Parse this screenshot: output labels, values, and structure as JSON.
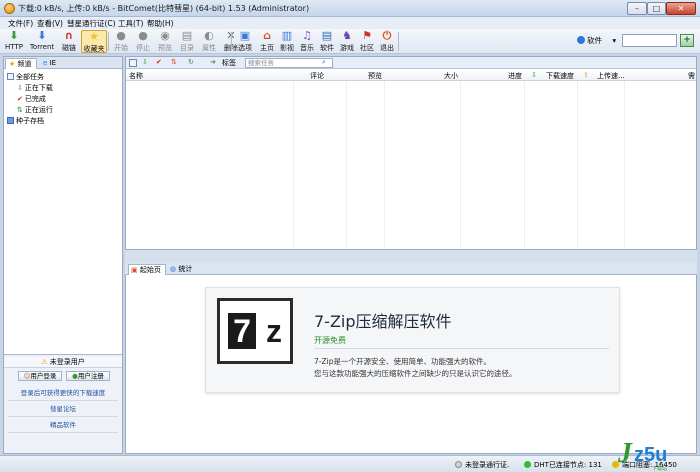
{
  "window": {
    "title": "下载:0 kB/s, 上传:0 kB/s - BitComet(比特彗星) (64-bit) 1.53 (Administrator)",
    "controls": [
      "–",
      "□",
      "✕"
    ]
  },
  "menu": [
    "文件(F)",
    "查看(V)",
    "彗星通行证(C)",
    "工具(T)",
    "帮助(H)"
  ],
  "toolbar": {
    "buttons": [
      {
        "label": "HTTP",
        "icon": "http-icon",
        "color": "#3c9b3c"
      },
      {
        "label": "Torrent",
        "icon": "torrent-icon",
        "color": "#3c7bd6"
      },
      {
        "label": "磁链",
        "icon": "magnet-icon",
        "color": "#d23b2b"
      },
      {
        "label": "收藏夹",
        "icon": "star-icon",
        "color": "#f2c230"
      },
      {
        "label": "开始",
        "icon": "start-icon",
        "color": "#8c8c8c"
      },
      {
        "label": "停止",
        "icon": "stop-icon",
        "color": "#8c8c8c"
      },
      {
        "label": "预览",
        "icon": "preview-icon",
        "color": "#8c8c8c"
      },
      {
        "label": "目录",
        "icon": "folder-icon",
        "color": "#8c8c8c"
      },
      {
        "label": "属性",
        "icon": "properties-icon",
        "color": "#8c8c8c"
      },
      {
        "label": "删除",
        "icon": "delete-icon",
        "color": "#6a6a6a"
      },
      {
        "label": "选项",
        "icon": "options-icon",
        "color": "#3c7bd6"
      },
      {
        "label": "主页",
        "icon": "home-icon",
        "color": "#d2542b"
      },
      {
        "label": "影视",
        "icon": "video-icon",
        "color": "#3c7bd6"
      },
      {
        "label": "音乐",
        "icon": "music-icon",
        "color": "#7c4fc9"
      },
      {
        "label": "软件",
        "icon": "software-icon",
        "color": "#2b6cb5"
      },
      {
        "label": "游戏",
        "icon": "game-icon",
        "color": "#6b3fb5"
      },
      {
        "label": "社区",
        "icon": "community-icon",
        "color": "#c9352b"
      },
      {
        "label": "退出",
        "icon": "exit-icon",
        "color": "#e0541f"
      }
    ],
    "search_category": "软件",
    "search_value": "",
    "search_go": "+"
  },
  "left": {
    "tabs": [
      "频道",
      "IE"
    ],
    "tree": [
      {
        "label": "全部任务",
        "icon": "all-tasks-icon",
        "color": "#ffffff"
      },
      {
        "label": "正在下载",
        "icon": "download-arrow-icon",
        "color": "#2ea02e"
      },
      {
        "label": "已完成",
        "icon": "check-icon",
        "color": "#d22a2a"
      },
      {
        "label": "正在运行",
        "icon": "running-icon",
        "color": "#2e8b2e"
      },
      {
        "label": "种子存档",
        "icon": "archive-icon",
        "color": "#3c7bd6"
      }
    ],
    "login": {
      "title": "未登录用户",
      "login_btn": "用户登录",
      "register_btn": "用户注册",
      "links": [
        "登录后可获得更快的下载速度",
        "彗星论坛",
        "精品软件"
      ]
    }
  },
  "tasks": {
    "toolbar_label": "标签",
    "search_placeholder": "搜索任务",
    "columns": [
      "名称",
      "评论",
      "预览",
      "大小",
      "进度",
      "下载速度",
      "上传速...",
      "需"
    ]
  },
  "bottom": {
    "tabs": [
      "起始页",
      "统计"
    ],
    "ad": {
      "logo_left": "7",
      "logo_right": "z",
      "title": "7-Zip压缩解压软件",
      "subtitle": "开源免费",
      "desc1": "7-Zip是一个开源安全、使用简单、功能强大的软件。",
      "desc2": "您与这款功能强大的压缩软件之间缺少的只是认识它的途径。"
    }
  },
  "status": {
    "login": "未登录通行证.",
    "dht": "DHT已连接节点: 131",
    "port": "端口阻塞: 16450"
  },
  "watermark": {
    "first": "J",
    "rest": "z5u",
    "small": "下载站"
  }
}
